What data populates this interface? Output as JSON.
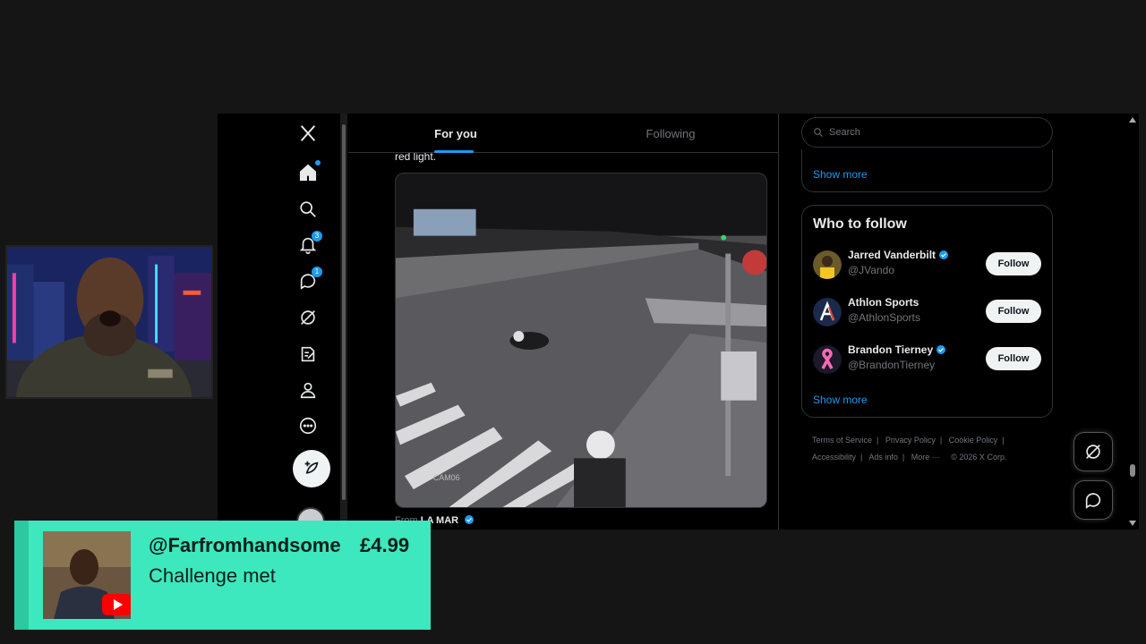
{
  "nav": {
    "items": [
      {
        "icon": "x-logo-icon",
        "badge": null
      },
      {
        "icon": "home-icon",
        "badge": null
      },
      {
        "icon": "search-icon",
        "badge": null
      },
      {
        "icon": "bell-icon",
        "badge": "3"
      },
      {
        "icon": "messages-icon",
        "badge": "1"
      },
      {
        "icon": "grok-icon",
        "badge": null
      },
      {
        "icon": "write-icon",
        "badge": null
      },
      {
        "icon": "profile-icon",
        "badge": null
      },
      {
        "icon": "more-icon",
        "badge": null
      }
    ]
  },
  "tabs": {
    "for_you": "For you",
    "following": "Following"
  },
  "tweet": {
    "text": "red light.",
    "media_label": "CAM06",
    "from_prefix": "From",
    "from_name": "LA MAR"
  },
  "search": {
    "placeholder": "Search"
  },
  "trends": {
    "show_more": "Show more"
  },
  "who_to_follow": {
    "title": "Who to follow",
    "users": [
      {
        "name": "Jarred Vanderbilt",
        "handle": "@JVando",
        "button": "Follow"
      },
      {
        "name": "Athlon Sports",
        "handle": "@AthlonSports",
        "button": "Follow"
      },
      {
        "name": "Brandon Tierney",
        "handle": "@BrandonTierney",
        "button": "Follow"
      }
    ],
    "show_more": "Show more"
  },
  "footer": {
    "links": [
      "Terms of Service",
      "Privacy Policy",
      "Cookie Policy",
      "Accessibility",
      "Ads info",
      "More ···"
    ],
    "copyright": "© 2026 X Corp."
  },
  "superchat": {
    "user": "@Farfromhandsome",
    "amount": "£4.99",
    "message": "Challenge met"
  },
  "colors": {
    "accent": "#1d9bf0",
    "superchat": "#3de8be"
  }
}
